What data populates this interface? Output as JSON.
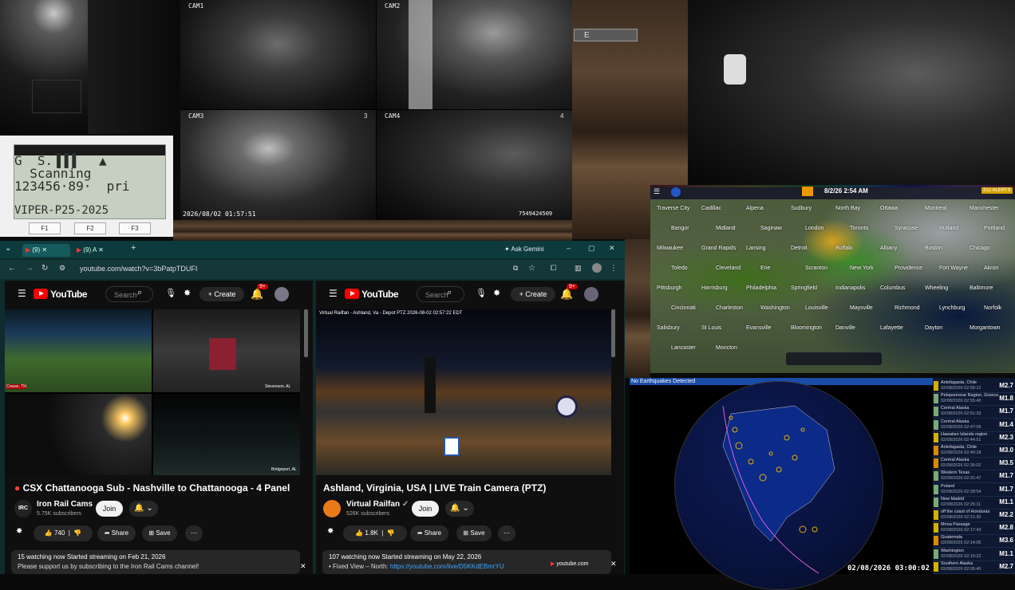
{
  "cams": {
    "c1": "CAM1",
    "c2": "CAM2",
    "c3": "CAM3",
    "c4": "CAM4",
    "n3": "3",
    "n4": "4",
    "timestamp": "2026/08/02 01:57:51",
    "corner_id": "7549424509"
  },
  "scanner": {
    "line1": "G  S.▐▐▐   ▲",
    "line2": "  Scanning",
    "line3": "123456·89·  pri",
    "line4": "VIPER-P25-2025",
    "f1": "F1",
    "f2": "F2",
    "f3": "F3"
  },
  "browser": {
    "tab1": "(9)",
    "tab2": "(9) A",
    "gemini": "Ask Gemini",
    "url": "youtube.com/watch?v=3bPatpTDUFI",
    "footer_url": "youtube.com"
  },
  "yt_left": {
    "logo_text": "YouTube",
    "search_placeholder": "Search",
    "create": "Create",
    "notif": "9+",
    "title": "CSX Chattanooga Sub - Nashville to Chattanooga - 4 Panel",
    "channel": "Iron Rail Cams",
    "channel_initials": "IRC",
    "subs": "5.75K subscribers",
    "join": "Join",
    "likes": "740",
    "share": "Share",
    "save": "Save",
    "desc_line1": "15 watching now  Started streaming on Feb 21, 2026",
    "desc_line2": "Please support us by subscribing to the Iron Rail Cams channel!",
    "overlay_bl": "Cowan, TN",
    "overlay_br": "Stevenson, AL",
    "overlay_br2": "Bridgeport, AL"
  },
  "yt_right": {
    "logo_text": "YouTube",
    "search_placeholder": "Search",
    "create": "Create",
    "notif": "9+",
    "overlay": "Virtual Railfan - Ashland, Va - Depot PTZ  2026-08-02  02:57:22 EDT",
    "title": "Ashland, Virginia, USA | LIVE Train Camera (PTZ)",
    "channel": "Virtual Railfan",
    "subs": "526K subscribers",
    "join": "Join",
    "likes": "1.8K",
    "share": "Share",
    "save": "Save",
    "desc_line1": "107 watching now  Started streaming on May 22, 2026",
    "desc_prefix": "• Fixed View – North: ",
    "desc_link": "https://youtube.com/live/D5KKdEBmrYU"
  },
  "radar": {
    "time": "8/2/26 2:54 AM",
    "alerts": "312 ALERTS",
    "cities": [
      "Traverse City",
      "Cadillac",
      "Alpena",
      "Sudbury",
      "North Bay",
      "Ottawa",
      "Montreal",
      "Manchester",
      "Bangor",
      "Midland",
      "Saginaw",
      "London",
      "Toronto",
      "Syracuse",
      "Rutland",
      "Portland",
      "Milwaukee",
      "Grand Rapids",
      "Lansing",
      "Detroit",
      "Buffalo",
      "Albany",
      "Boston",
      "Chicago",
      "Toledo",
      "Cleveland",
      "Erie",
      "Scranton",
      "New York",
      "Providence",
      "Fort Wayne",
      "Akron",
      "Pittsburgh",
      "Harrisburg",
      "Philadelphia",
      "Springfield",
      "Indianapolis",
      "Columbus",
      "Wheeling",
      "Baltimore",
      "Cincinnati",
      "Charleston",
      "Washington",
      "Louisville",
      "Maysville",
      "Richmond",
      "Lynchburg",
      "Norfolk",
      "Salisbury",
      "St Louis",
      "Evansville",
      "Bloomington",
      "Danville",
      "Lafayette",
      "Dayton",
      "Morgantown",
      "Lancaster",
      "Moncton"
    ]
  },
  "eq": {
    "header": "No Earthquakes Detected",
    "time": "02/08/2026 03:00:02",
    "list": [
      {
        "place": "Antofagasta, Chile",
        "time": "02/08/2026 02:58:12",
        "mag": "M2.7",
        "color": "#d4b000"
      },
      {
        "place": "Peloponnese Region, Greece",
        "time": "02/08/2026 02:55:40",
        "mag": "M1.8",
        "color": "#7a7"
      },
      {
        "place": "Central Alaska",
        "time": "02/08/2026 02:51:33",
        "mag": "M1.7",
        "color": "#7a7"
      },
      {
        "place": "Central Alaska",
        "time": "02/08/2026 02:47:09",
        "mag": "M1.4",
        "color": "#7a7"
      },
      {
        "place": "Hawaiian Islands region",
        "time": "02/08/2026 02:44:51",
        "mag": "M2.3",
        "color": "#d4b000"
      },
      {
        "place": "Antofagasta, Chile",
        "time": "02/08/2026 02:40:18",
        "mag": "M3.0",
        "color": "#d98a00"
      },
      {
        "place": "Central Alaska",
        "time": "02/08/2026 02:36:02",
        "mag": "M3.5",
        "color": "#d98a00"
      },
      {
        "place": "Western Texas",
        "time": "02/08/2026 02:31:47",
        "mag": "M1.7",
        "color": "#7a7"
      },
      {
        "place": "Poland",
        "time": "02/08/2026 02:28:54",
        "mag": "M1.7",
        "color": "#7a7"
      },
      {
        "place": "New Madrid",
        "time": "02/08/2026 02:25:11",
        "mag": "M1.1",
        "color": "#7a7"
      },
      {
        "place": "off the coast of Honduras",
        "time": "02/08/2026 02:21:30",
        "mag": "M2.2",
        "color": "#d4b000"
      },
      {
        "place": "Mona Passage",
        "time": "02/08/2026 02:17:43",
        "mag": "M2.8",
        "color": "#d4b000"
      },
      {
        "place": "Guatemala",
        "time": "02/08/2026 02:14:05",
        "mag": "M3.6",
        "color": "#d98a00"
      },
      {
        "place": "Washington",
        "time": "02/08/2026 02:10:22",
        "mag": "M1.1",
        "color": "#7a7"
      },
      {
        "place": "Southern Alaska",
        "time": "02/08/2026 02:06:40",
        "mag": "M2.7",
        "color": "#d4b000"
      }
    ]
  }
}
